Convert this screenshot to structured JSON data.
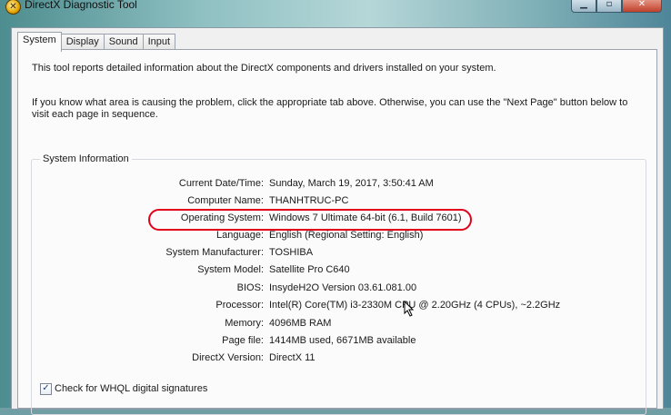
{
  "window": {
    "title": "DirectX Diagnostic Tool",
    "icon": "x-icon",
    "icon_glyph": "✕",
    "minimize_glyph": "▁",
    "maximize_glyph": "▫",
    "close_glyph": "✕"
  },
  "tabs": [
    {
      "label": "System",
      "active": true
    },
    {
      "label": "Display",
      "active": false
    },
    {
      "label": "Sound",
      "active": false
    },
    {
      "label": "Input",
      "active": false
    }
  ],
  "intro": {
    "line1": "This tool reports detailed information about the DirectX components and drivers installed on your system.",
    "line2": "If you know what area is causing the problem, click the appropriate tab above.  Otherwise, you can use the \"Next Page\" button below to visit each page in sequence."
  },
  "system_info": {
    "group_label": "System Information",
    "rows": [
      {
        "label": "Current Date/Time:",
        "value": "Sunday, March 19, 2017, 3:50:41 AM"
      },
      {
        "label": "Computer Name:",
        "value": "THANHTRUC-PC"
      },
      {
        "label": "Operating System:",
        "value": "Windows 7 Ultimate 64-bit (6.1, Build 7601)"
      },
      {
        "label": "Language:",
        "value": "English (Regional Setting: English)"
      },
      {
        "label": "System Manufacturer:",
        "value": "TOSHIBA"
      },
      {
        "label": "System Model:",
        "value": "Satellite Pro C640"
      },
      {
        "label": "BIOS:",
        "value": "InsydeH2O Version 03.61.081.00"
      },
      {
        "label": "Processor:",
        "value": "Intel(R) Core(TM) i3-2330M CPU @ 2.20GHz (4 CPUs), ~2.2GHz"
      },
      {
        "label": "Memory:",
        "value": "4096MB RAM"
      },
      {
        "label": "Page file:",
        "value": "1414MB used, 6671MB available"
      },
      {
        "label": "DirectX Version:",
        "value": "DirectX 11"
      }
    ]
  },
  "whql": {
    "label": "Check for WHQL digital signatures",
    "checked": true,
    "check_glyph": "✓"
  },
  "colors": {
    "highlight": "#e3001b"
  }
}
